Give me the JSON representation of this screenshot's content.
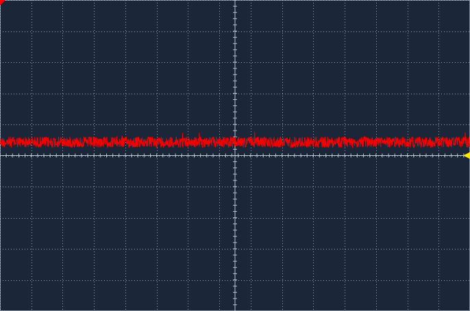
{
  "scope": {
    "divisions": {
      "horizontal": 15,
      "vertical": 10
    },
    "grid_visible": true,
    "colors": {
      "background": "#1b2638",
      "grid": "#c9d2dd",
      "trace": "#ff0000",
      "marker": "#ffea00"
    },
    "channel_trace": {
      "level_div": 0.43,
      "noise_peak_to_peak_div": 0.35,
      "shape": "noise"
    },
    "ground_marker": {
      "level_div": 0,
      "side": "right"
    },
    "trigger_marker": {
      "position": "top-left"
    },
    "icons": {
      "ground_marker": "triangle-left-icon",
      "trigger_marker": "triangle-down-icon"
    }
  }
}
